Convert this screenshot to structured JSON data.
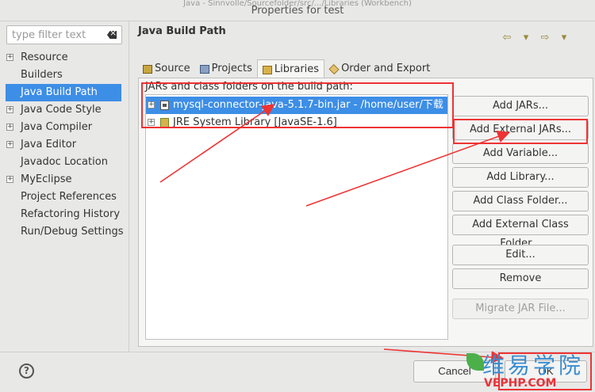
{
  "window": {
    "title": "Properties for test",
    "ghost_title": "Java - Sinnvolle/Sourcefolder/src/.../Libraries (Workbench)"
  },
  "filter": {
    "placeholder": "type filter text"
  },
  "nav": {
    "items": [
      {
        "label": "Resource",
        "expandable": true
      },
      {
        "label": "Builders",
        "expandable": false
      },
      {
        "label": "Java Build Path",
        "expandable": false,
        "selected": true
      },
      {
        "label": "Java Code Style",
        "expandable": true
      },
      {
        "label": "Java Compiler",
        "expandable": true
      },
      {
        "label": "Java Editor",
        "expandable": true
      },
      {
        "label": "Javadoc Location",
        "expandable": false
      },
      {
        "label": "MyEclipse",
        "expandable": true
      },
      {
        "label": "Project References",
        "expandable": false
      },
      {
        "label": "Refactoring History",
        "expandable": false
      },
      {
        "label": "Run/Debug Settings",
        "expandable": false
      }
    ]
  },
  "page": {
    "title": "Java Build Path"
  },
  "tabs": [
    {
      "label": "Source",
      "icon": "source-folder-icon"
    },
    {
      "label": "Projects",
      "icon": "projects-icon"
    },
    {
      "label": "Libraries",
      "icon": "libraries-icon",
      "active": true
    },
    {
      "label": "Order and Export",
      "icon": "order-export-icon"
    }
  ],
  "libraries": {
    "label": "JARs and class folders on the build path:",
    "entries": [
      {
        "label": "mysql-connector-java-5.1.7-bin.jar - /home/user/下载",
        "icon": "jar-icon",
        "selected": true
      },
      {
        "label": "JRE System Library [JavaSE-1.6]",
        "icon": "library-icon",
        "selected": false
      }
    ]
  },
  "buttons": {
    "add_jars": "Add JARs...",
    "add_external_jars": "Add External JARs...",
    "add_variable": "Add Variable...",
    "add_library": "Add Library...",
    "add_class_folder": "Add Class Folder...",
    "add_external_class_folder": "Add External Class Folder...",
    "edit": "Edit...",
    "remove": "Remove",
    "migrate_jar": "Migrate JAR File..."
  },
  "dialog": {
    "help": "?",
    "cancel": "Cancel",
    "ok": "OK"
  },
  "watermark": {
    "cn": "维易学院",
    "en": "VEPHP.COM"
  },
  "colors": {
    "selection": "#3d8ee6",
    "annotation": "#ee3333"
  }
}
